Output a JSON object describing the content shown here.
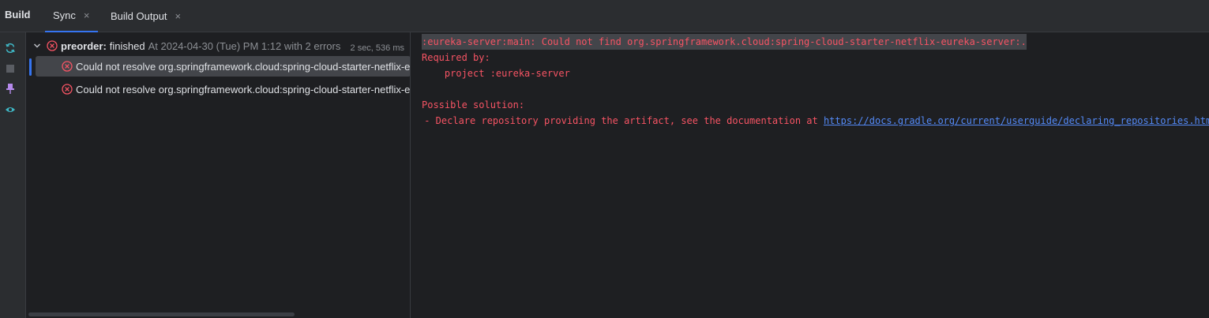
{
  "header": {
    "panel_title": "Build",
    "tabs": [
      {
        "label": "Sync",
        "close": "×"
      },
      {
        "label": "Build Output",
        "close": "×"
      }
    ]
  },
  "toolbar": {
    "icons": [
      "sync-icon",
      "stop-icon",
      "pin-icon",
      "eye-icon"
    ]
  },
  "tree": {
    "root": {
      "name": "preorder:",
      "status": "finished",
      "details": "At 2024-04-30 (Tue) PM 1:12 with 2 errors",
      "duration": "2 sec, 536 ms"
    },
    "items": [
      {
        "text": "Could not resolve org.springframework.cloud:spring-cloud-starter-netflix-eureka-server:."
      },
      {
        "text": "Could not resolve org.springframework.cloud:spring-cloud-starter-netflix-eureka-server:."
      }
    ]
  },
  "console": {
    "line1": ":eureka-server:main: Could not find org.springframework.cloud:spring-cloud-starter-netflix-eureka-server:.",
    "line2": "Required by:",
    "line3": "    project :eureka-server",
    "line4": "Possible solution:",
    "line5_prefix": " - Declare repository providing the artifact, see the documentation at ",
    "line5_link": "https://docs.gradle.org/current/userguide/declaring_repositories.html"
  },
  "colors": {
    "accent": "#3574f0",
    "error": "#f75464",
    "link": "#548af7",
    "icon_teal": "#3fb7c5",
    "icon_purple": "#b589ec"
  }
}
